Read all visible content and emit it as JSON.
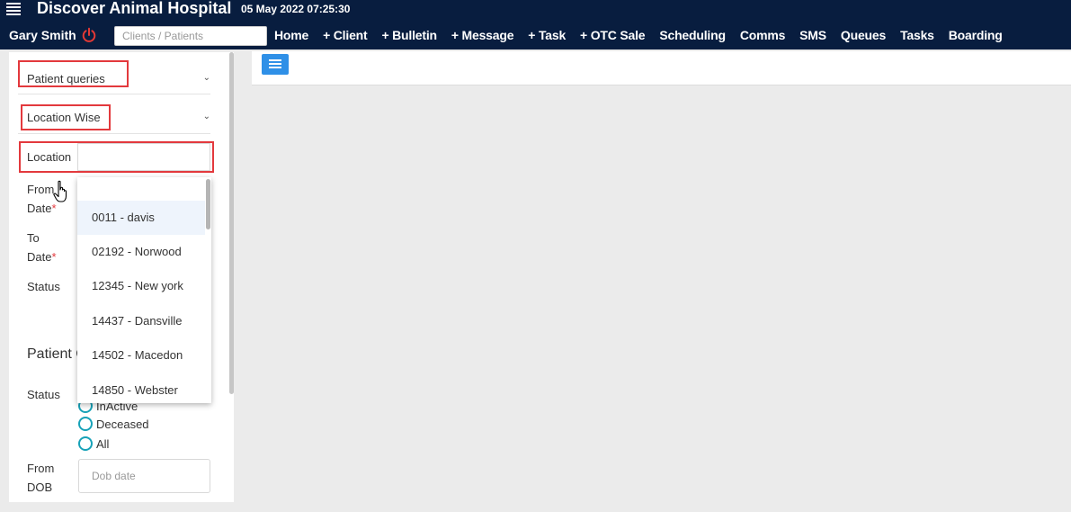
{
  "header": {
    "title": "Discover Animal Hospital",
    "datetime": "05 May 2022 07:25:30",
    "user": "Gary Smith",
    "search_placeholder": "Clients / Patients",
    "nav": [
      "Home",
      "+ Client",
      "+ Bulletin",
      "+ Message",
      "+ Task",
      "+ OTC Sale",
      "Scheduling",
      "Comms",
      "SMS",
      "Queues",
      "Tasks",
      "Boarding"
    ]
  },
  "filters": {
    "query_type": "Patient queries",
    "query_mode": "Location Wise",
    "location_label": "Location",
    "location_value": "",
    "from_date_label_1": "From",
    "from_date_label_2": "Date",
    "to_date_label_1": "To",
    "to_date_label_2": "Date",
    "required_marker": "*",
    "status_label": "Status",
    "section_title": "Patient C",
    "patient_status_label": "Status",
    "status_options": [
      "InActive",
      "Deceased",
      "All"
    ],
    "from_dob_label_1": "From",
    "from_dob_label_2": "DOB",
    "dob_placeholder": "Dob date"
  },
  "location_dropdown": {
    "options": [
      "0011 - davis",
      "02192 - Norwood",
      "12345 - New york",
      "14437 - Dansville",
      "14502 - Macedon",
      "14850 - Webster"
    ],
    "highlighted_index": 0
  },
  "icons": {
    "menu": "hamburger-icon",
    "power": "power-icon",
    "chevron": "chevron-down-icon",
    "cursor": "hand-cursor-icon"
  },
  "colors": {
    "header_bg": "#081d3f",
    "accent": "#2f90e7",
    "power_icon": "#e53935",
    "highlight_box": "#e3393d",
    "radio": "#17a2b8"
  }
}
